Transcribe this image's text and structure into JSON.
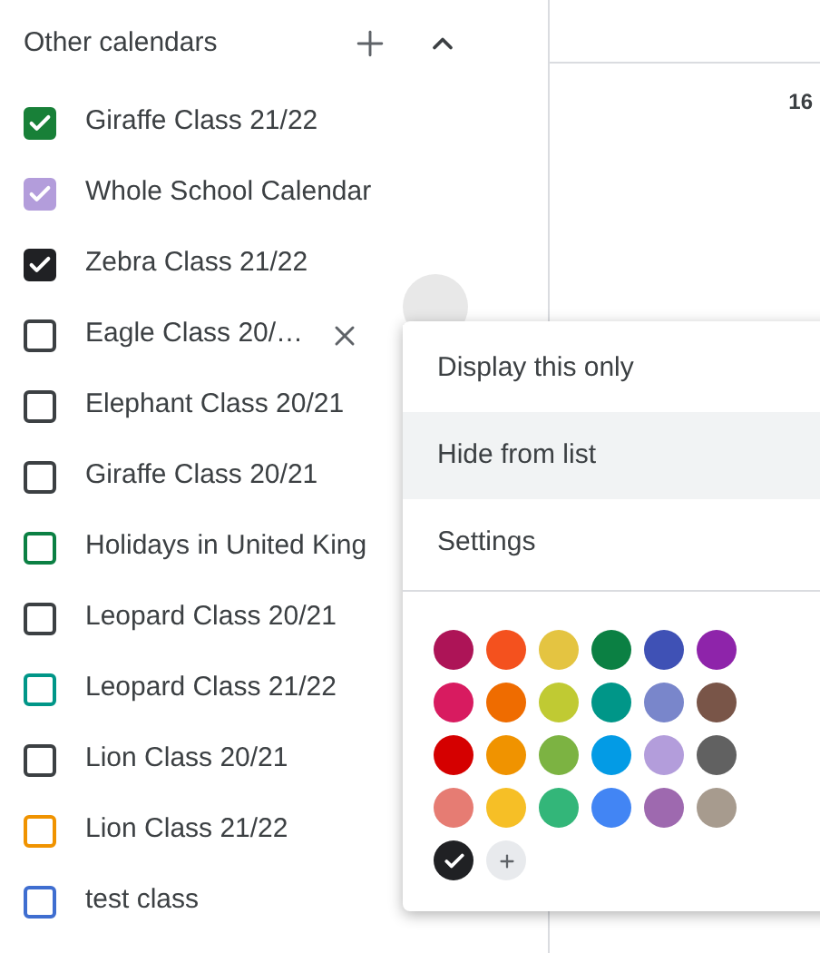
{
  "sidebar": {
    "title": "Other calendars",
    "calendars": [
      {
        "label": "Giraffe Class 21/22",
        "checked": true,
        "color": "#188038",
        "hovered": false
      },
      {
        "label": "Whole School Calendar",
        "checked": true,
        "color": "#b39ddb",
        "hovered": false
      },
      {
        "label": "Zebra Class 21/22",
        "checked": true,
        "color": "#202124",
        "hovered": false
      },
      {
        "label": "Eagle Class 20/…",
        "checked": false,
        "color": "#3c4043",
        "hovered": true
      },
      {
        "label": "Elephant Class 20/21",
        "checked": false,
        "color": "#3c4043",
        "hovered": false
      },
      {
        "label": "Giraffe Class 20/21",
        "checked": false,
        "color": "#3c4043",
        "hovered": false
      },
      {
        "label": "Holidays in United King",
        "checked": false,
        "color": "#0b8043",
        "hovered": false
      },
      {
        "label": "Leopard Class 20/21",
        "checked": false,
        "color": "#3c4043",
        "hovered": false
      },
      {
        "label": "Leopard Class 21/22",
        "checked": false,
        "color": "#009688",
        "hovered": false
      },
      {
        "label": "Lion Class 20/21",
        "checked": false,
        "color": "#3c4043",
        "hovered": false
      },
      {
        "label": "Lion Class 21/22",
        "checked": false,
        "color": "#f09300",
        "hovered": false
      },
      {
        "label": "test class",
        "checked": false,
        "color": "#3f6ed0",
        "hovered": false
      }
    ]
  },
  "calendar_view": {
    "date": "16"
  },
  "context_menu": {
    "items": [
      {
        "label": "Display this only",
        "selected": false
      },
      {
        "label": "Hide from list",
        "selected": true
      },
      {
        "label": "Settings",
        "selected": false
      }
    ],
    "palette": [
      {
        "color": "#ad1457",
        "selected": false
      },
      {
        "color": "#f4511e",
        "selected": false
      },
      {
        "color": "#e4c441",
        "selected": false
      },
      {
        "color": "#0b8043",
        "selected": false
      },
      {
        "color": "#3f51b5",
        "selected": false
      },
      {
        "color": "#8e24aa",
        "selected": false
      },
      {
        "color": "#d81b60",
        "selected": false
      },
      {
        "color": "#ef6c00",
        "selected": false
      },
      {
        "color": "#c0ca33",
        "selected": false
      },
      {
        "color": "#009688",
        "selected": false
      },
      {
        "color": "#7986cb",
        "selected": false
      },
      {
        "color": "#795548",
        "selected": false
      },
      {
        "color": "#d50000",
        "selected": false
      },
      {
        "color": "#f09300",
        "selected": false
      },
      {
        "color": "#7cb342",
        "selected": false
      },
      {
        "color": "#039be5",
        "selected": false
      },
      {
        "color": "#b39ddb",
        "selected": false
      },
      {
        "color": "#616161",
        "selected": false
      },
      {
        "color": "#e67c73",
        "selected": false
      },
      {
        "color": "#f6bf26",
        "selected": false
      },
      {
        "color": "#33b679",
        "selected": false
      },
      {
        "color": "#4285f4",
        "selected": false
      },
      {
        "color": "#9e69af",
        "selected": false
      },
      {
        "color": "#a79b8e",
        "selected": false
      },
      {
        "color": "#202124",
        "selected": true
      }
    ]
  }
}
